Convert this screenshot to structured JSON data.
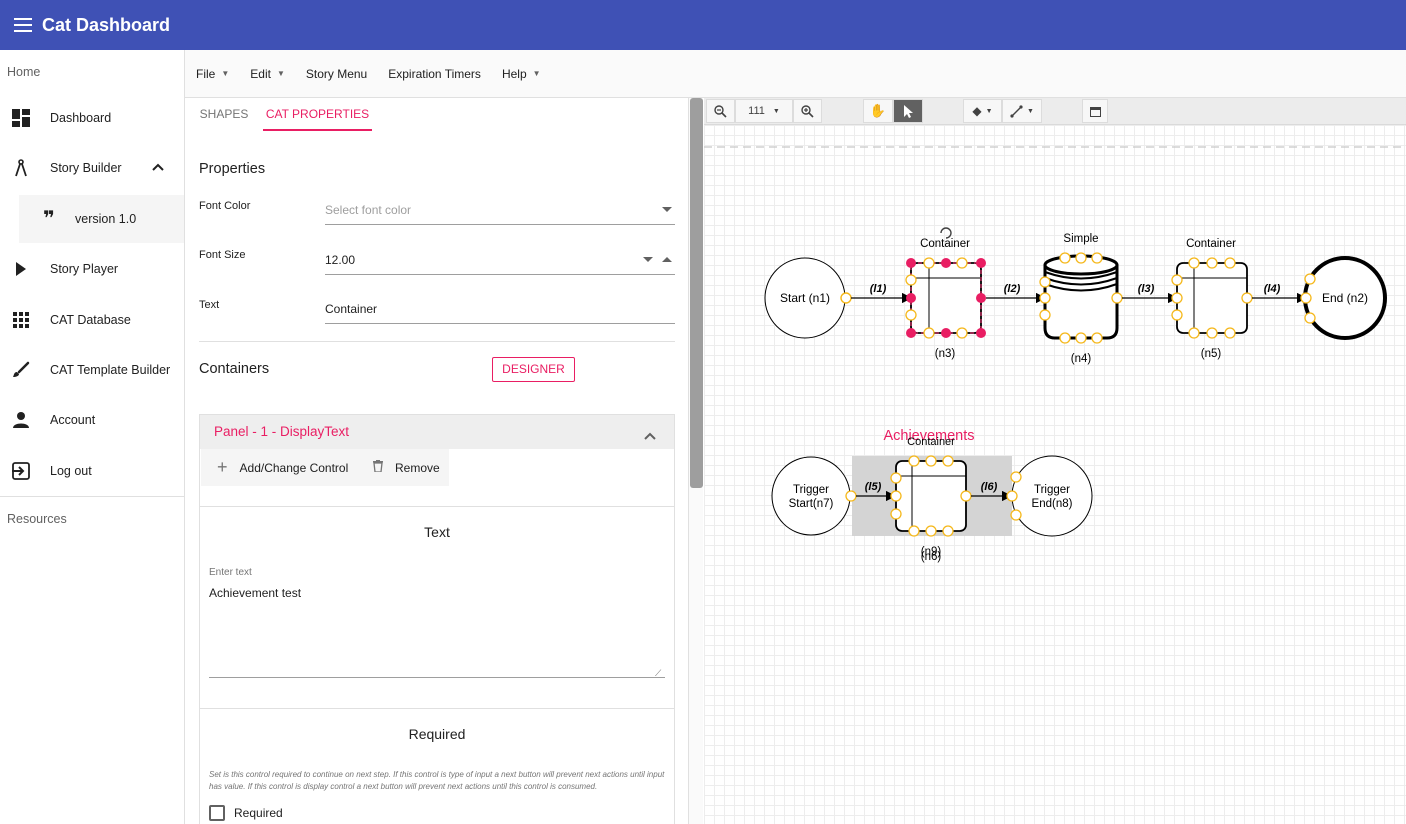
{
  "app": {
    "title": "Cat Dashboard"
  },
  "sidebar": {
    "home_label": "Home",
    "items": [
      {
        "label": "Dashboard",
        "icon": "dashboard-icon"
      },
      {
        "label": "Story Builder",
        "icon": "compass-icon"
      },
      {
        "label": "version 1.0",
        "icon": "quote-icon"
      },
      {
        "label": "Story Player",
        "icon": "play-icon"
      },
      {
        "label": "CAT Database",
        "icon": "grid-icon"
      },
      {
        "label": "CAT Template Builder",
        "icon": "brush-icon"
      },
      {
        "label": "Account",
        "icon": "person-icon"
      },
      {
        "label": "Log out",
        "icon": "logout-icon"
      }
    ],
    "resources_label": "Resources"
  },
  "menubar": {
    "items": [
      "File",
      "Edit",
      "Story Menu",
      "Expiration Timers",
      "Help"
    ]
  },
  "tabs": {
    "shapes": "SHAPES",
    "cat_properties": "CAT PROPERTIES"
  },
  "properties": {
    "title": "Properties",
    "font_color_label": "Font Color",
    "font_color_placeholder": "Select font color",
    "font_size_label": "Font Size",
    "font_size_value": "12.00",
    "text_label": "Text",
    "text_value": "Container"
  },
  "containers": {
    "title": "Containers",
    "designer_button": "DESIGNER",
    "panel_title": "Panel - 1 - DisplayText",
    "add_change_label": "Add/Change Control",
    "remove_label": "Remove",
    "text_control_title": "Text",
    "enter_text_label": "Enter text",
    "enter_text_value": "Achievement test",
    "required_title": "Required",
    "required_help": "Set is this control required to continue on next step. If this control is type of input a next button will prevent next actions until input has value. If this control is display control a next button will prevent next actions until this control is consumed.",
    "required_checkbox_label": "Required"
  },
  "canvas_toolbar": {
    "zoom": "111"
  },
  "diagram": {
    "nodes": {
      "n1": "Start (n1)",
      "n2": "End (n2)",
      "n3_title": "Container",
      "n3_id": "(n3)",
      "n4_title": "Simple",
      "n4_id": "(n4)",
      "n5_title": "Container",
      "n5_id": "(n5)",
      "n7_line1": "Trigger",
      "n7_line2": "Start(n7)",
      "n8_line1": "Trigger",
      "n8_line2": "End(n8)",
      "n9_title": "Container",
      "n9_id": "(n9)",
      "n6_overlap": "(n6)"
    },
    "links": [
      "(l1)",
      "(l2)",
      "(l3)",
      "(l4)",
      "(l5)",
      "(l6)"
    ],
    "achievements_label": "Achievements",
    "colors": {
      "selection": "#e91e63",
      "port": "#f5b81b",
      "achievements": "#e91e63"
    }
  }
}
